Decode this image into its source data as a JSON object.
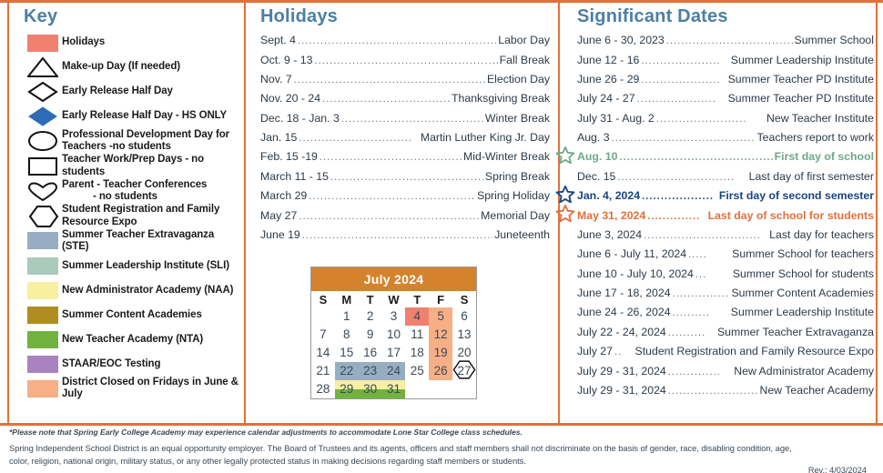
{
  "colors": {
    "accent_orange": "#E2703A",
    "heading_blue": "#4C7FA4",
    "cal_header_orange": "#D4832C",
    "holiday_red": "#F08070",
    "ste_blue_gray": "#97AEC2",
    "sli_green_gray": "#A9CBBB",
    "naa_yellow": "#F6F0A0",
    "sca_olive": "#B08D20",
    "nta_green": "#72B33F",
    "staar_purple": "#A883C0",
    "district_closed_peach": "#F7AF86",
    "star_green": "#6FA88C",
    "star_blue": "#17457F",
    "star_orange": "#E2703A"
  },
  "key": {
    "title": "Key",
    "items": [
      {
        "symbol": "filled-square",
        "color": "#F08070",
        "label": "Holidays"
      },
      {
        "symbol": "triangle-outline",
        "color": "#000000",
        "label": "Make-up Day (If needed)"
      },
      {
        "symbol": "diamond-outline",
        "color": "#000000",
        "label": "Early Release Half Day"
      },
      {
        "symbol": "diamond-filled",
        "color": "#2E6CB5",
        "label": "Early Release Half Day - HS ONLY"
      },
      {
        "symbol": "ellipse-outline",
        "color": "#000000",
        "label": "Professional Development Day for Teachers -no students"
      },
      {
        "symbol": "rectangle-outline",
        "color": "#000000",
        "label": "Teacher Work/Prep Days - no students"
      },
      {
        "symbol": "heart-outline",
        "color": "#000000",
        "label": "Parent - Teacher Conferences       - no students"
      },
      {
        "symbol": "hexagon-outline",
        "color": "#000000",
        "label": "Student Registration and Family Resource Expo"
      },
      {
        "symbol": "filled-square",
        "color": "#97AEC2",
        "label": "Summer Teacher Extravaganza (STE)"
      },
      {
        "symbol": "filled-square",
        "color": "#A9CBBB",
        "label": "Summer Leadership Institute (SLI)"
      },
      {
        "symbol": "filled-square",
        "color": "#F6F0A0",
        "label": "New Administrator Academy (NAA)"
      },
      {
        "symbol": "filled-square",
        "color": "#B08D20",
        "label": "Summer Content Academies"
      },
      {
        "symbol": "filled-square",
        "color": "#72B33F",
        "label": "New Teacher Academy (NTA)"
      },
      {
        "symbol": "filled-square",
        "color": "#A883C0",
        "label": "STAAR/EOC Testing"
      },
      {
        "symbol": "filled-square",
        "color": "#F7AF86",
        "label": "District Closed on Fridays in June & July"
      }
    ]
  },
  "holidays": {
    "title": "Holidays",
    "entries": [
      {
        "date": "Sept. 4",
        "name": "Labor Day"
      },
      {
        "date": "Oct. 9 - 13",
        "name": "Fall Break"
      },
      {
        "date": "Nov. 7",
        "name": "Election Day"
      },
      {
        "date": "Nov. 20 - 24",
        "name": "Thanksgiving Break"
      },
      {
        "date": "Dec. 18 - Jan. 3",
        "name": "Winter Break"
      },
      {
        "date": "Jan. 15",
        "name": "Martin Luther King Jr. Day"
      },
      {
        "date": "Feb. 15 -19",
        "name": "Mid-Winter Break"
      },
      {
        "date": "March 11 - 15",
        "name": "Spring Break"
      },
      {
        "date": "March 29",
        "name": "Spring Holiday"
      },
      {
        "date": "May 27",
        "name": "Memorial Day"
      },
      {
        "date": "June 19",
        "name": "Juneteenth"
      }
    ]
  },
  "significant_dates": {
    "title": "Significant Dates",
    "entries": [
      {
        "date": "June 6 - 30, 2023",
        "name": "Summer School",
        "star": ""
      },
      {
        "date": "June 12 - 16",
        "name": "Summer Leadership Institute",
        "star": ""
      },
      {
        "date": "June 26 - 29",
        "name": "Summer Teacher PD Institute",
        "star": ""
      },
      {
        "date": "July 24 - 27",
        "name": "Summer Teacher PD Institute",
        "star": ""
      },
      {
        "date": "July 31 - Aug. 2",
        "name": "New Teacher Institute",
        "star": ""
      },
      {
        "date": "Aug. 3",
        "name": "Teachers report to work",
        "star": ""
      },
      {
        "date": "Aug. 10",
        "name": "First day of school",
        "star": "green"
      },
      {
        "date": "Dec. 15",
        "name": "Last day of first semester",
        "star": ""
      },
      {
        "date": "Jan. 4, 2024",
        "name": "First day of second semester",
        "star": "blue"
      },
      {
        "date": "May 31, 2024",
        "name": "Last day of school for students",
        "star": "orange"
      },
      {
        "date": "June 3, 2024",
        "name": "Last day for teachers",
        "star": ""
      },
      {
        "date": "June 6 - July 11, 2024",
        "name": "Summer School for teachers",
        "star": ""
      },
      {
        "date": "June 10 - July 10, 2024",
        "name": "Summer School for students",
        "star": ""
      },
      {
        "date": "June 17 - 18, 2024",
        "name": "Summer Content Academies",
        "star": ""
      },
      {
        "date": "June 24 - 26, 2024",
        "name": "Summer Leadership Institute",
        "star": ""
      },
      {
        "date": "July 22 - 24, 2024",
        "name": "Summer Teacher Extravaganza",
        "star": ""
      },
      {
        "date": "July 27",
        "name": "Student Registration and Family Resource Expo",
        "star": ""
      },
      {
        "date": "July 29 - 31, 2024",
        "name": "New Administrator Academy",
        "star": ""
      },
      {
        "date": "July 29 - 31, 2024",
        "name": "New Teacher Academy",
        "star": ""
      }
    ]
  },
  "calendar": {
    "title": "July 2024",
    "weekdays": [
      "S",
      "M",
      "T",
      "W",
      "T",
      "F",
      "S"
    ],
    "weeks": [
      [
        {
          "day": ""
        },
        {
          "day": "1"
        },
        {
          "day": "2"
        },
        {
          "day": "3"
        },
        {
          "day": "4",
          "fill": "#F08070"
        },
        {
          "day": "5",
          "fill": "#F7AF86"
        },
        {
          "day": "6"
        }
      ],
      [
        {
          "day": "7"
        },
        {
          "day": "8"
        },
        {
          "day": "9"
        },
        {
          "day": "10"
        },
        {
          "day": "11"
        },
        {
          "day": "12",
          "fill": "#F7AF86"
        },
        {
          "day": "13"
        }
      ],
      [
        {
          "day": "14"
        },
        {
          "day": "15"
        },
        {
          "day": "16"
        },
        {
          "day": "17"
        },
        {
          "day": "18"
        },
        {
          "day": "19",
          "fill": "#F7AF86"
        },
        {
          "day": "20"
        }
      ],
      [
        {
          "day": "21"
        },
        {
          "day": "22",
          "fill": "#97AEC2"
        },
        {
          "day": "23",
          "fill": "#97AEC2"
        },
        {
          "day": "24",
          "fill": "#97AEC2"
        },
        {
          "day": "25"
        },
        {
          "day": "26",
          "fill": "#F7AF86"
        },
        {
          "day": "27",
          "mark": "hexagon"
        }
      ],
      [
        {
          "day": "28"
        },
        {
          "day": "29",
          "fill": "#72B33F",
          "fill_top": "#F6F0A0"
        },
        {
          "day": "30",
          "fill": "#72B33F",
          "fill_top": "#F6F0A0"
        },
        {
          "day": "31",
          "fill": "#72B33F",
          "fill_top": "#F6F0A0"
        },
        {
          "day": ""
        },
        {
          "day": ""
        },
        {
          "day": ""
        }
      ]
    ]
  },
  "footer": {
    "note": "*Please note that Spring Early College Academy may experience calendar adjustments to accommodate Lone Star College class schedules.",
    "eeo_line1": "Spring Independent School District is an equal opportunity employer. The Board of Trustees and its agents, officers and staff members shall not discriminate on the basis of gender, race, disabling condition, age,",
    "eeo_line2": "color, religion, national origin, military status, or any other legally protected status in making decisions regarding staff members or students.",
    "revision": "Rev.: 4/03/2024"
  }
}
